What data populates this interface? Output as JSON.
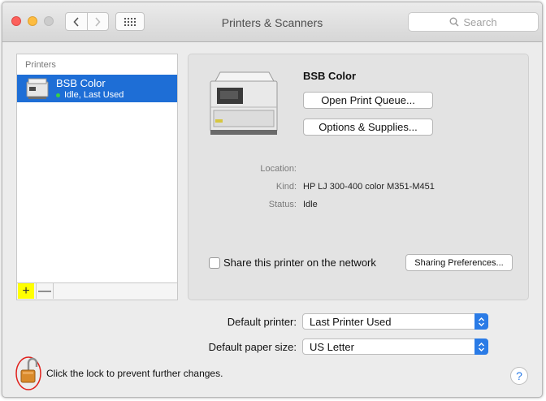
{
  "window": {
    "title": "Printers & Scanners"
  },
  "search": {
    "placeholder": "Search",
    "icon": "search-icon"
  },
  "sidebar": {
    "header": "Printers",
    "printers": [
      {
        "name": "BSB Color",
        "status": "Idle, Last Used"
      }
    ],
    "add_label": "+",
    "remove_label": "—",
    "add_highlight_color": "#ffff00"
  },
  "detail": {
    "printer_name": "BSB Color",
    "open_queue_label": "Open Print Queue...",
    "options_label": "Options & Supplies...",
    "location_label": "Location:",
    "location_value": "",
    "kind_label": "Kind:",
    "kind_value": "HP LJ 300-400 color M351-M451",
    "status_label": "Status:",
    "status_value": "Idle",
    "share_label": "Share this printer on the network",
    "share_checked": false,
    "sharing_prefs_label": "Sharing Preferences..."
  },
  "defaults": {
    "printer_label": "Default printer:",
    "printer_value": "Last Printer Used",
    "paper_label": "Default paper size:",
    "paper_value": "US Letter"
  },
  "footer": {
    "lock_text": "Click the lock to prevent further changes.",
    "help_label": "?",
    "lock_state": "unlocked",
    "annotation_color": "#e0201b"
  },
  "colors": {
    "selection": "#1e6ed6",
    "accent": "#2a7be6",
    "status_dot": "#38d043"
  }
}
